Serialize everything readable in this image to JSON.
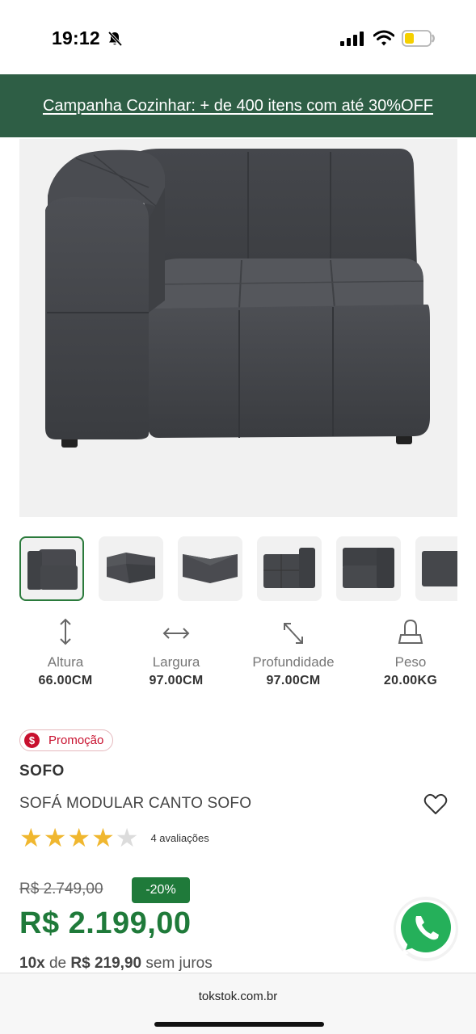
{
  "status_bar": {
    "time": "19:12",
    "icons": [
      "bell-off-icon",
      "signal-icon",
      "wifi-icon",
      "battery-low-icon"
    ]
  },
  "promo_banner": {
    "text": "Campanha Cozinhar: + de 400 itens com até 30%OFF"
  },
  "gallery": {
    "main_image": "charcoal-modular-corner-sofa",
    "thumbnail_count_visible": 6,
    "active_thumbnail": 1
  },
  "specs": [
    {
      "icon": "height-arrows-icon",
      "label": "Altura",
      "value": "66.00CM"
    },
    {
      "icon": "width-arrows-icon",
      "label": "Largura",
      "value": "97.00CM"
    },
    {
      "icon": "depth-arrows-icon",
      "label": "Profundidade",
      "value": "97.00CM"
    },
    {
      "icon": "weight-icon",
      "label": "Peso",
      "value": "20.00KG"
    }
  ],
  "product": {
    "badge_icon_text": "$",
    "badge": "Promoção",
    "brand": "SOFO",
    "name": "SOFÁ MODULAR CANTO SOFO",
    "rating": 4,
    "rating_max": 5,
    "rating_count": "4 avaliações",
    "old_price": "R$ 2.749,00",
    "discount": "-20%",
    "price": "R$ 2.199,00",
    "installments": {
      "count": "10x",
      "connector": "de",
      "value": "R$ 219,90",
      "suffix": "sem juros"
    }
  },
  "browser": {
    "url": "tokstok.com.br"
  },
  "colors": {
    "banner_green": "#2e5e45",
    "price_green": "#1f7a3a",
    "promo_red": "#c8102e",
    "star_gold": "#f0b72f"
  }
}
